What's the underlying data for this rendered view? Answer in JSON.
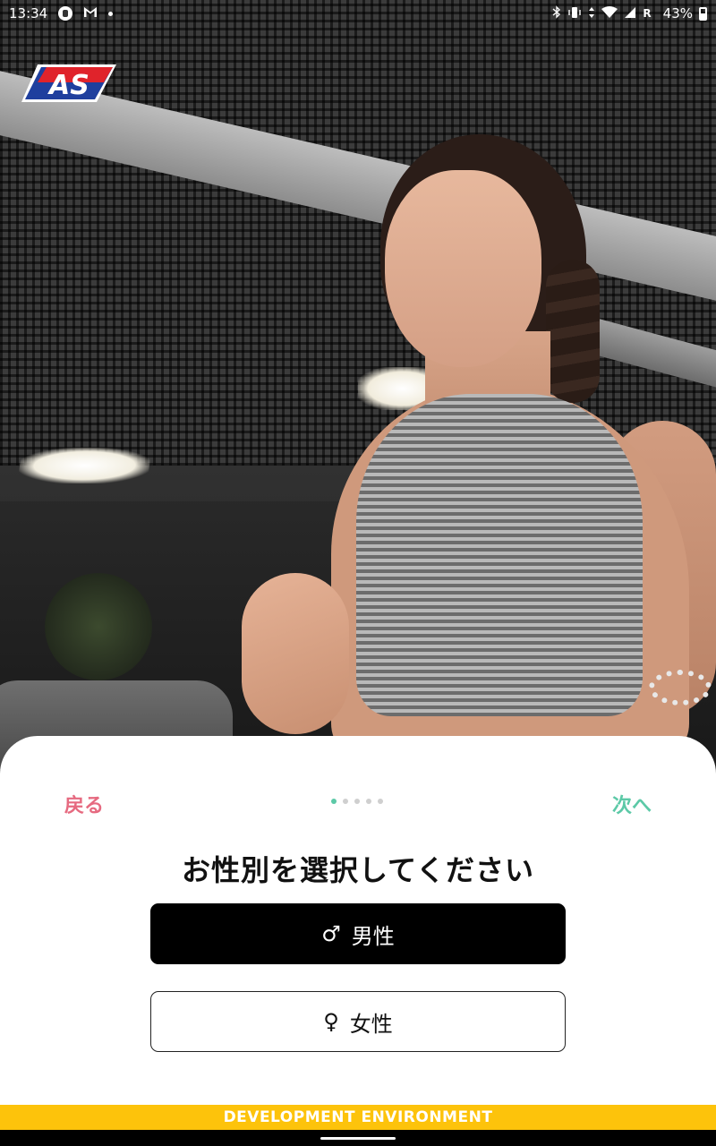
{
  "status_bar": {
    "time": "13:34",
    "battery_percent": "43%",
    "signal_label": "R",
    "left_icons": [
      "notification-badge-icon",
      "gmail-icon",
      "dot-icon"
    ],
    "right_icons": [
      "bluetooth-icon",
      "vibrate-icon",
      "data-arrows-icon",
      "wifi-icon",
      "signal-icon",
      "battery-icon"
    ]
  },
  "logo": {
    "text": "AS",
    "colors": {
      "red": "#e0232b",
      "blue": "#1f3f9e"
    }
  },
  "sheet": {
    "back_label": "戻る",
    "next_label": "次へ",
    "pager": {
      "total": 5,
      "active_index": 0
    },
    "question": "お性別を選択してください",
    "options": [
      {
        "icon": "♂",
        "icon_name": "male-icon",
        "label": "男性",
        "selected": true
      },
      {
        "icon": "♀",
        "icon_name": "female-icon",
        "label": "女性",
        "selected": false
      }
    ]
  },
  "banner": {
    "text": "DEVELOPMENT ENVIRONMENT",
    "color": "#fdc30b"
  },
  "colors": {
    "back": "#e66a80",
    "next": "#5cc9a7"
  }
}
